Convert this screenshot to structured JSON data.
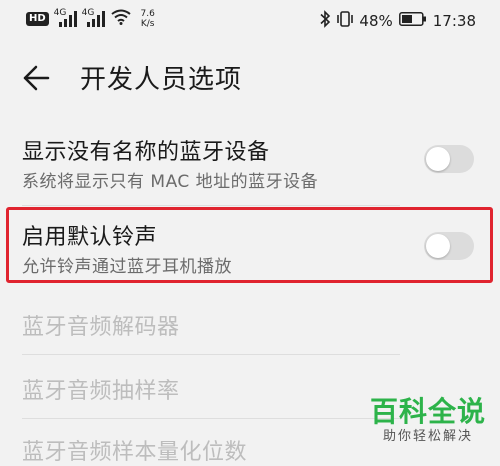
{
  "status_bar": {
    "hd_label": "HD",
    "sim1_label": "4G",
    "sim2_label": "4G",
    "net_speed_value": "7.6",
    "net_speed_unit": "K/s",
    "battery_text": "48%",
    "time": "17:38",
    "icons": [
      "hd-icon",
      "signal-icon",
      "signal-icon",
      "wifi-icon",
      "bluetooth-icon",
      "vibrate-icon",
      "battery-icon"
    ]
  },
  "toolbar": {
    "back_icon": "arrow-left-icon",
    "title": "开发人员选项"
  },
  "settings": [
    {
      "title": "显示没有名称的蓝牙设备",
      "subtitle": "系统将显示只有 MAC 地址的蓝牙设备",
      "toggle_on": false,
      "enabled": true
    },
    {
      "title": "启用默认铃声",
      "subtitle": "允许铃声通过蓝牙耳机播放",
      "toggle_on": false,
      "enabled": true,
      "highlighted": true
    },
    {
      "title": "蓝牙音频解码器",
      "enabled": false
    },
    {
      "title": "蓝牙音频抽样率",
      "enabled": false
    },
    {
      "title": "蓝牙音频样本量化位数",
      "enabled": false
    }
  ],
  "colors": {
    "highlight_border": "#e0242f",
    "watermark_green": "#2db34a",
    "disabled_text": "#bdbdbd"
  },
  "watermark": {
    "main": "百科全说",
    "sub": "助你轻松解决"
  }
}
